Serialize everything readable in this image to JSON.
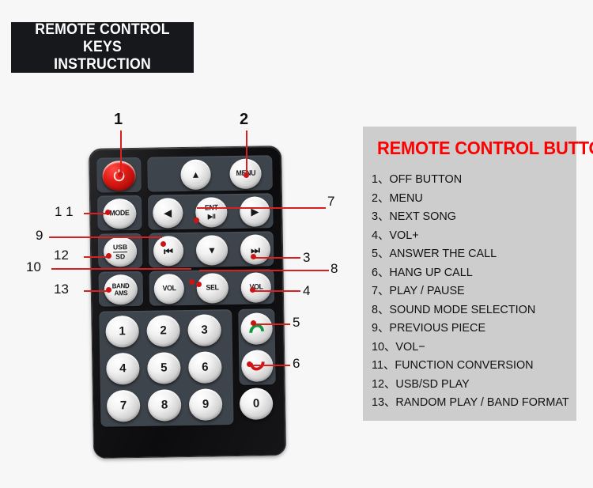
{
  "header": {
    "line1": "REMOTE CONTROL KEYS",
    "line2": "INSTRUCTION"
  },
  "legend": {
    "title": "REMOTE CONTROL BUTTON",
    "items": [
      {
        "num": "1、",
        "text": "OFF BUTTON"
      },
      {
        "num": "2、",
        "text": "MENU"
      },
      {
        "num": "3、",
        "text": "NEXT SONG"
      },
      {
        "num": "4、",
        "text": "VOL+"
      },
      {
        "num": "5、",
        "text": "ANSWER THE CALL"
      },
      {
        "num": "6、",
        "text": "HANG UP CALL"
      },
      {
        "num": "7、",
        "text": "PLAY / PAUSE"
      },
      {
        "num": "8、",
        "text": "SOUND MODE SELECTION"
      },
      {
        "num": "9、",
        "text": "PREVIOUS PIECE"
      },
      {
        "num": "10、",
        "text": "VOL−"
      },
      {
        "num": "11、",
        "text": "FUNCTION CONVERSION"
      },
      {
        "num": "12、",
        "text": "USB/SD PLAY"
      },
      {
        "num": "13、",
        "text": "RANDOM PLAY / BAND FORMAT"
      }
    ]
  },
  "remote": {
    "keys": {
      "power": "",
      "up": "▲",
      "menu": "MENU",
      "mode": "MODE",
      "left": "◀",
      "ent_top": "ENT",
      "ent_bottom": "▶II",
      "right": "▶",
      "usb": "USB",
      "sd": "SD",
      "prev": "⏮",
      "down": "▼",
      "next": "⏭",
      "band": "BAND",
      "ams": "AMS",
      "vol_down": "VOL",
      "sel": "SEL",
      "vol_up": "VOL",
      "call_answer": "",
      "call_end": "",
      "n1": "1",
      "n2": "2",
      "n3": "3",
      "n4": "4",
      "n5": "5",
      "n6": "6",
      "n7": "7",
      "n8": "8",
      "n9": "9",
      "n0": "0"
    }
  },
  "callouts": [
    {
      "id": "1",
      "label": "1"
    },
    {
      "id": "2",
      "label": "2"
    },
    {
      "id": "3",
      "label": "3"
    },
    {
      "id": "4",
      "label": "4"
    },
    {
      "id": "5",
      "label": "5"
    },
    {
      "id": "6",
      "label": "6"
    },
    {
      "id": "7",
      "label": "7"
    },
    {
      "id": "8",
      "label": "8"
    },
    {
      "id": "9",
      "label": "9"
    },
    {
      "id": "10",
      "label": "10"
    },
    {
      "id": "11",
      "label": "1 1"
    },
    {
      "id": "12",
      "label": "12"
    },
    {
      "id": "13",
      "label": "13"
    }
  ],
  "colors": {
    "accent_red": "#fe0000",
    "leader_red": "#d82020",
    "panel_gray": "#cdcdcd",
    "header_black": "#17181c",
    "page_bg": "#f7f7f7"
  }
}
